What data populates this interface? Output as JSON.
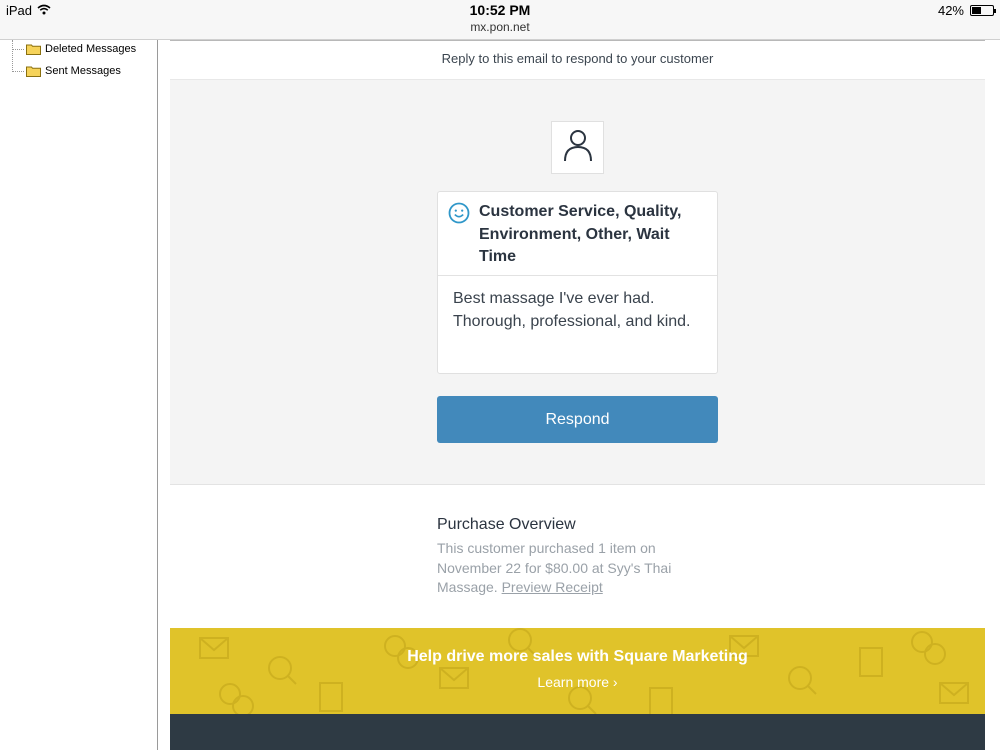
{
  "status_bar": {
    "device": "iPad",
    "time": "10:52 PM",
    "url": "mx.pon.net",
    "battery": "42%",
    "battery_level": 0.42
  },
  "folders": [
    {
      "label": "Deleted Messages",
      "icon": "folder-icon"
    },
    {
      "label": "Sent Messages",
      "icon": "folder-icon"
    }
  ],
  "email": {
    "reply_note": "Reply to this email to respond to your customer",
    "review": {
      "avatar_icon": "person-icon",
      "sentiment_icon": "smile-icon",
      "tags": "Customer Service, Quality, Environment, Other, Wait Time",
      "comment": "Best massage I've ever had. Thorough, professional, and kind."
    },
    "respond_label": "Respond",
    "purchase": {
      "title": "Purchase Overview",
      "text": "This customer purchased 1 item on November 22 for $80.00 at Syy's Thai Massage.",
      "link": "Preview Receipt"
    },
    "promo": {
      "title": "Help drive more sales with Square Marketing",
      "link": "Learn more ›"
    }
  },
  "colors": {
    "accent": "#4289bb",
    "promo": "#e0c32a",
    "footer": "#2e3a44",
    "smile": "#2f97c9"
  }
}
